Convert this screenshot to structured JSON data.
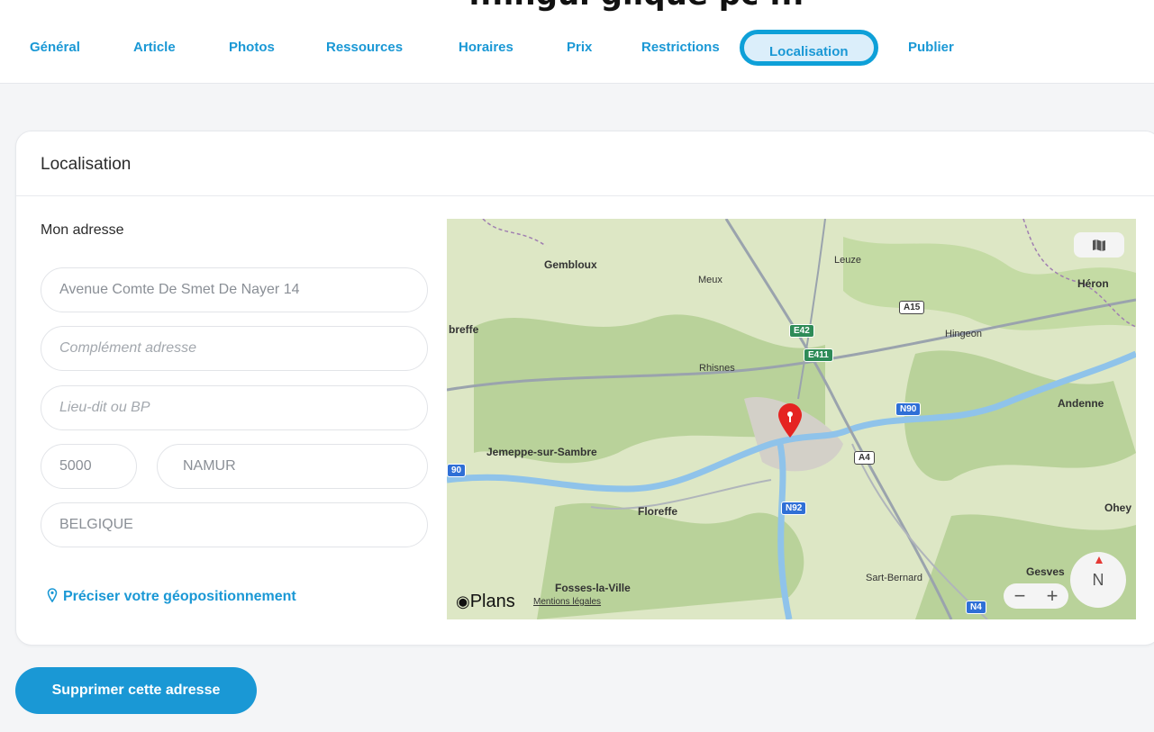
{
  "header": {
    "cut_title": "...ingui glique pc ..."
  },
  "tabs": [
    {
      "label": "Général"
    },
    {
      "label": "Article"
    },
    {
      "label": "Photos"
    },
    {
      "label": "Ressources"
    },
    {
      "label": "Horaires"
    },
    {
      "label": "Prix"
    },
    {
      "label": "Restrictions"
    },
    {
      "label": "Localisation",
      "active": true
    },
    {
      "label": "Publier"
    }
  ],
  "card": {
    "title": "Localisation",
    "section_label": "Mon adresse",
    "fields": {
      "street_value": "Avenue Comte De Smet De Nayer 14",
      "complement_placeholder": "Complément adresse",
      "lieu_placeholder": "Lieu-dit ou BP",
      "postcode_value": "5000",
      "city_value": "NAMUR",
      "country_value": "BELGIQUE"
    },
    "geo_link": "Préciser votre géopositionnement"
  },
  "map": {
    "cities": [
      "Gembloux",
      "Meux",
      "Leuze",
      "Héron",
      "Hingeon",
      "Rhisnes",
      "Andenne",
      "Jemeppe-sur-Sambre",
      "Floreffe",
      "Ohey",
      "Sart-Bernard",
      "Gesves",
      "Fosses-la-Ville",
      "breffe"
    ],
    "shields": [
      "A15",
      "E42",
      "E411",
      "N90",
      "A4",
      "N92",
      "N4",
      "90"
    ],
    "brand": "Plans",
    "legal": "Mentions légales",
    "compass": "N",
    "zoom_minus": "−",
    "zoom_plus": "+",
    "icons": {
      "map_mode": "map-icon",
      "pin": "location-pin-icon"
    }
  },
  "actions": {
    "delete_label": "Supprimer cette adresse"
  },
  "colors": {
    "accent": "#1a98d5",
    "ring": "#0ea0d8"
  }
}
